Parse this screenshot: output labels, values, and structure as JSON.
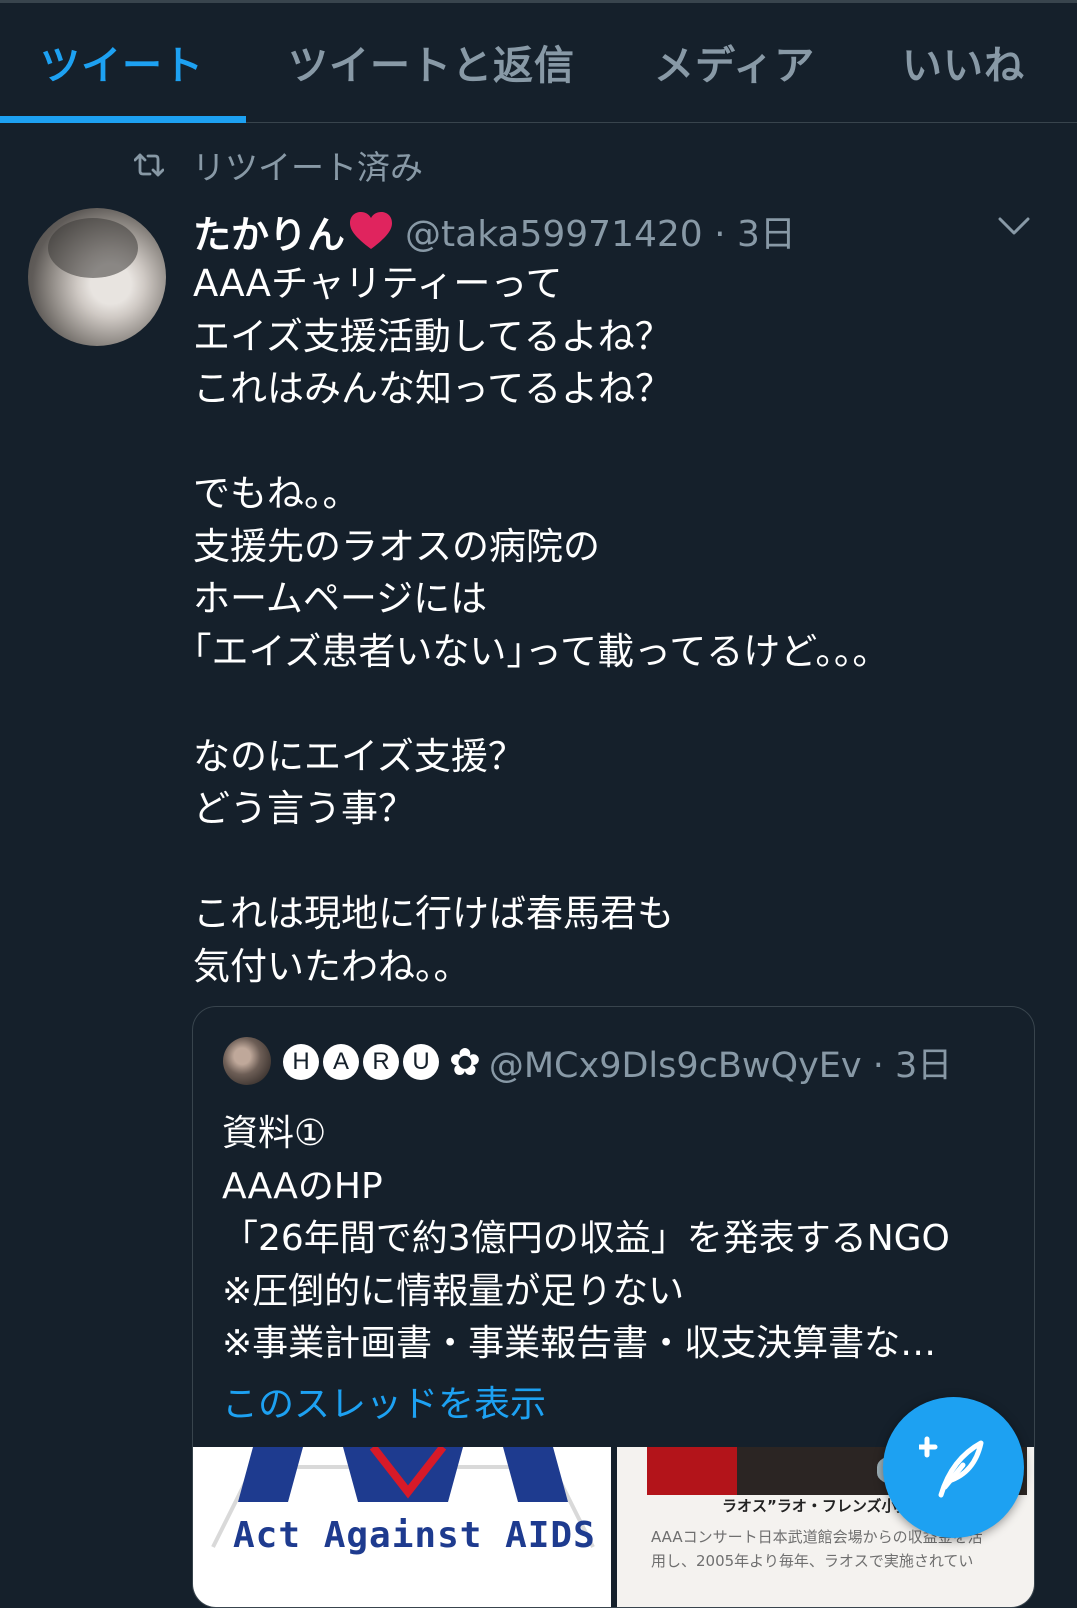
{
  "tabs": [
    {
      "label": "ツイート",
      "active": true
    },
    {
      "label": "ツイートと返信",
      "active": false
    },
    {
      "label": "メディア",
      "active": false
    },
    {
      "label": "いいね",
      "active": false
    }
  ],
  "retweet_label": "リツイート済み",
  "tweet": {
    "author_name": "たかりん",
    "author_emoji": "heart-icon",
    "handle_time": "@taka59971420 · 3日",
    "text": "AAAチャリティーって\nエイズ支援活動してるよね？\nこれはみんな知ってるよね？\n\nでもね。。\n支援先のラオスの病院の\nホームページには\n｢エイズ患者いない｣って載ってるけど。。。\n\nなのにエイズ支援？\nどう言う事？\n\nこれは現地に行けば春馬君も\n気付いたわね。。"
  },
  "quote": {
    "name_letters": [
      "H",
      "A",
      "R",
      "U"
    ],
    "name_suffix": "✿",
    "handle_time": "@MCx9Dls9cBwQyEv · 3日",
    "text": "資料①\nAAAのHP\n「26年間で約3億円の収益」を発表するNGO\n※圧倒的に情報量が足りない\n※事業計画書・事業報告書・収支決算書な…",
    "thread_link": "このスレッドを表示",
    "image1_text": "Act Against AIDS",
    "image2_caption": "ラオス”ラオ・フレンズ小児病",
    "image2_desc": "AAAコンサート日本武道館会場からの収益金を活\n用し、2005年より毎年、ラオスで実施されてい"
  },
  "colors": {
    "background": "#15202b",
    "accent": "#1da1f2",
    "muted": "#8899a6",
    "border": "#38444d",
    "heart": "#e0245e"
  }
}
